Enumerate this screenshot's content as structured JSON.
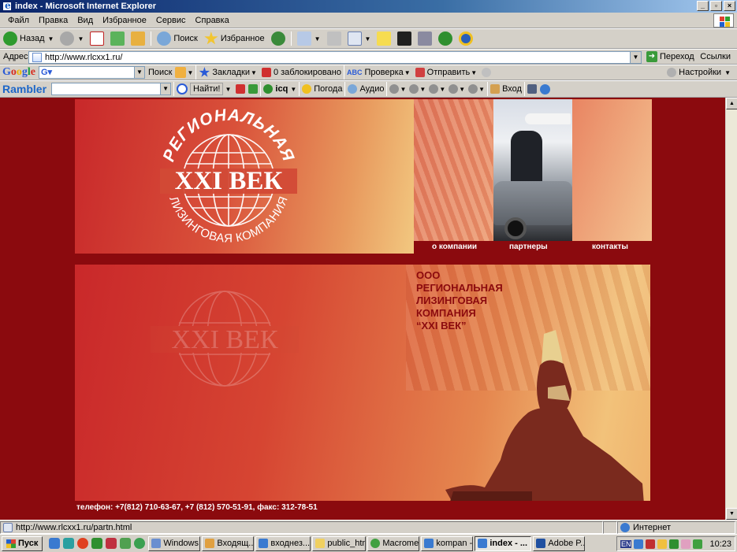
{
  "window": {
    "title": "index - Microsoft Internet Explorer"
  },
  "menu": [
    "Файл",
    "Правка",
    "Вид",
    "Избранное",
    "Сервис",
    "Справка"
  ],
  "toolbar": {
    "back": "Назад",
    "search": "Поиск",
    "favorites": "Избранное"
  },
  "address": {
    "label": "Адрес:",
    "url": "http://www.rlcxx1.ru/",
    "go": "Переход",
    "links": "Ссылки"
  },
  "google_bar": {
    "logo": "Google",
    "search": "Поиск",
    "bookmarks": "Закладки",
    "blocked": "0 заблокировано",
    "check": "Проверка",
    "send": "Отправить",
    "settings": "Настройки"
  },
  "rambler_bar": {
    "logo": "Rambler",
    "find": "Найти!",
    "icq": "icq",
    "weather": "Погода",
    "audio": "Аудио",
    "login": "Вход"
  },
  "site": {
    "logo_arc": "РЕГИОНАЛЬНАЯ",
    "logo_main": "XXI ВЕК",
    "logo_bottom": "ЛИЗИНГОВАЯ КОМПАНИЯ",
    "nav": [
      "о компании",
      "партнеры",
      "контакты"
    ],
    "company": [
      "ООО",
      "РЕГИОНАЛЬНАЯ",
      "ЛИЗИНГОВАЯ",
      "КОМПАНИЯ",
      "“XXI ВЕК”"
    ],
    "phone": "телефон: +7(812) 710-63-67, +7 (812) 570-51-91, факс: 312-78-51"
  },
  "status": {
    "url": "http://www.rlcxx1.ru/partn.html",
    "zone": "Интернет"
  },
  "taskbar": {
    "start": "Пуск",
    "tasks": [
      "Windows...",
      "Входящ...",
      "входнез...",
      "public_html",
      "Macrome...",
      "kompan -...",
      "index - ...",
      "Adobe P..."
    ],
    "lang": "EN",
    "clock": "10:23"
  },
  "colors": {
    "site_bg": "#8b0a0e",
    "accent": "#c8282a"
  }
}
